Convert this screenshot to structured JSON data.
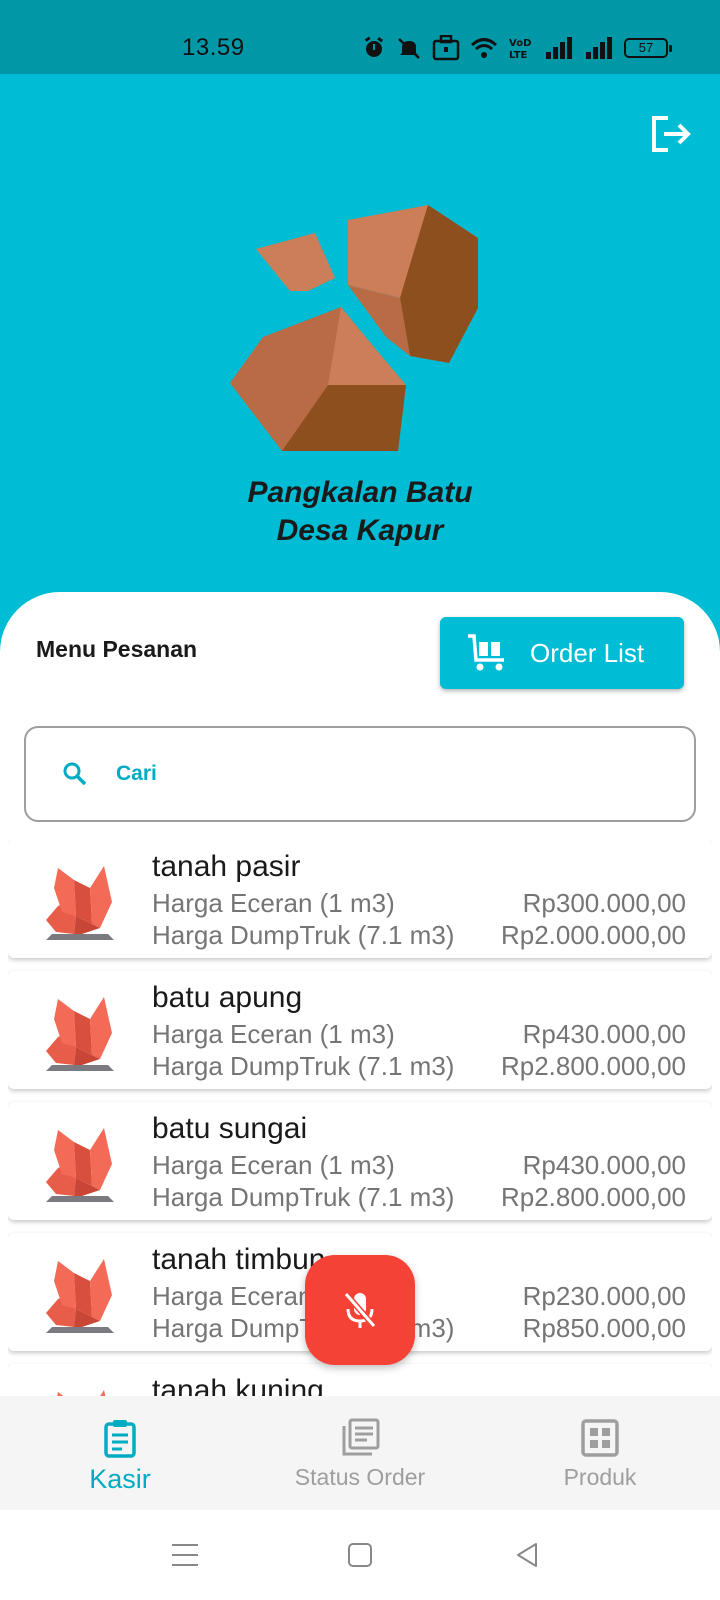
{
  "status_bar": {
    "time": "13.59",
    "network_label": "VoLTE",
    "battery": "57",
    "icons": [
      "alarm-icon",
      "mute-icon",
      "briefcase-icon",
      "wifi-icon",
      "volte-icon",
      "signal-icon",
      "signal-icon",
      "battery-icon"
    ]
  },
  "header": {
    "app_name_line1": "Pangkalan Batu",
    "app_name_line2": "Desa Kapur",
    "logout_icon": "logout-icon"
  },
  "menu": {
    "title": "Menu Pesanan",
    "order_list_label": "Order List"
  },
  "search": {
    "placeholder": "Cari",
    "value": ""
  },
  "products": [
    {
      "name": "tanah pasir",
      "retail_label": "Harga Eceran (1 m3)",
      "retail_price": "Rp300.000,00",
      "truck_label": "Harga DumpTruk (7.1 m3)",
      "truck_price": "Rp2.000.000,00"
    },
    {
      "name": "batu apung",
      "retail_label": "Harga Eceran (1 m3)",
      "retail_price": "Rp430.000,00",
      "truck_label": "Harga DumpTruk (7.1 m3)",
      "truck_price": "Rp2.800.000,00"
    },
    {
      "name": "batu sungai",
      "retail_label": "Harga Eceran (1 m3)",
      "retail_price": "Rp430.000,00",
      "truck_label": "Harga DumpTruk (7.1 m3)",
      "truck_price": "Rp2.800.000,00"
    },
    {
      "name": "tanah timbun",
      "retail_label": "Harga Eceran (1 m3)",
      "retail_price": "Rp230.000,00",
      "truck_label": "Harga DumpTruk (7.1 m3)",
      "truck_price": "Rp850.000,00"
    },
    {
      "name": "tanah kuning",
      "retail_label": "",
      "retail_price": "",
      "truck_label": "",
      "truck_price": ""
    }
  ],
  "bottom_nav": {
    "items": [
      {
        "label": "Kasir",
        "icon": "clipboard-icon",
        "active": true
      },
      {
        "label": "Status Order",
        "icon": "news-icon",
        "active": false
      },
      {
        "label": "Produk",
        "icon": "grid-icon",
        "active": false
      }
    ]
  },
  "colors": {
    "primary": "#00bcd4",
    "status_bar": "#0097a7",
    "mic_fab": "#f44336",
    "text_secondary": "#757575",
    "nav_inactive": "#9e9e9e"
  }
}
